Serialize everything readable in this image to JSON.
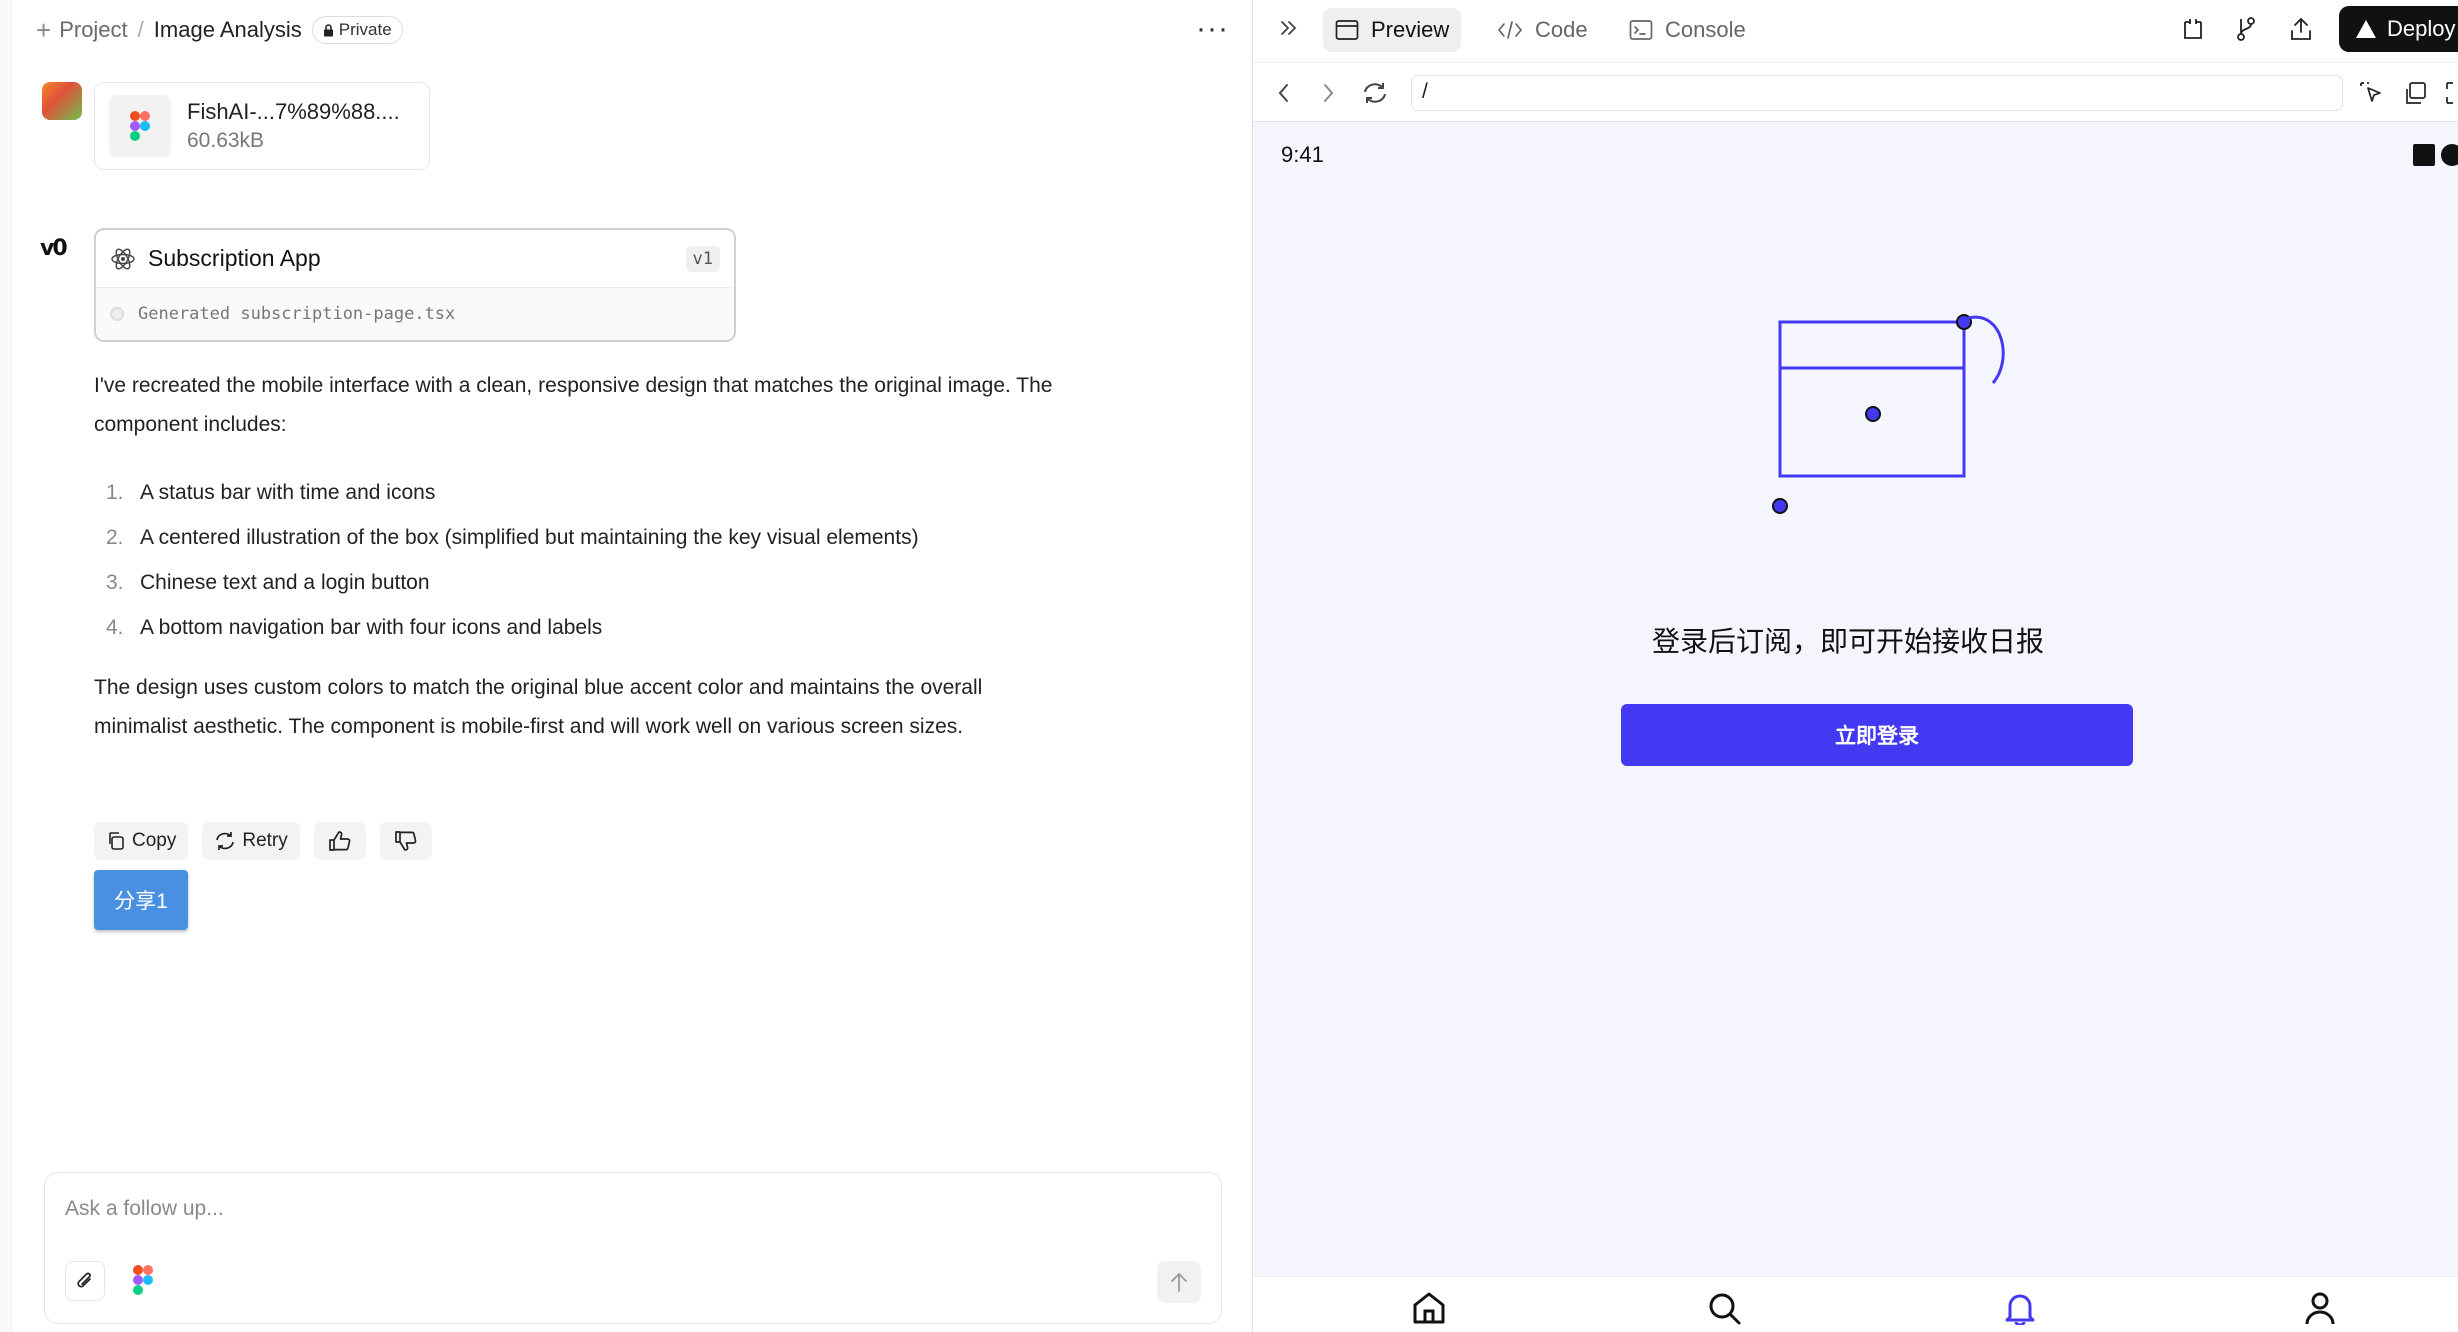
{
  "header": {
    "project_label": "Project",
    "separator": "/",
    "project_name": "Image Analysis",
    "visibility": "Private",
    "more_label": "···"
  },
  "attachment": {
    "name": "FishAI-...7%89%88....",
    "size": "60.63kB"
  },
  "generation": {
    "logo": "v0",
    "title": "Subscription App",
    "version": "v1",
    "status": "Generated subscription-page.tsx"
  },
  "message": {
    "intro": "I've recreated the mobile interface with a clean, responsive design that matches the original image. The component includes:",
    "items": [
      {
        "num": "1.",
        "text": "A status bar with time and icons"
      },
      {
        "num": "2.",
        "text": "A centered illustration of the box (simplified but maintaining the key visual elements)"
      },
      {
        "num": "3.",
        "text": "Chinese text and a login button"
      },
      {
        "num": "4.",
        "text": "A bottom navigation bar with four icons and labels"
      }
    ],
    "outro": "The design uses custom colors to match the original blue accent color and maintains the overall minimalist aesthetic. The component is mobile-first and will work well on various screen sizes."
  },
  "actions": {
    "copy": "Copy",
    "retry": "Retry",
    "share": "分享1"
  },
  "composer": {
    "placeholder": "Ask a follow up..."
  },
  "preview": {
    "tabs": {
      "preview": "Preview",
      "code": "Code",
      "console": "Console"
    },
    "deploy": "Deploy",
    "url": "/",
    "status_time": "9:41",
    "login_text": "登录后订阅，即可开始接收日报",
    "login_button": "立即登录",
    "accent_color": "#4439f2",
    "nav_icons": [
      "home-icon",
      "search-icon",
      "bell-icon",
      "user-icon"
    ]
  }
}
